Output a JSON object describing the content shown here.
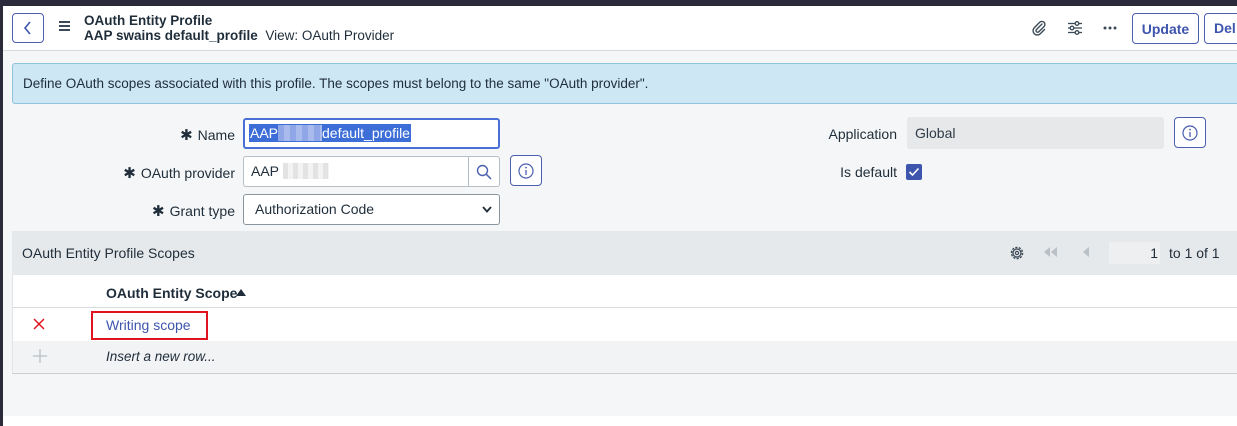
{
  "header": {
    "title": "OAuth Entity Profile",
    "record_name": "AAP swains default_profile",
    "view_label": "View: OAuth Provider",
    "update_label": "Update",
    "delete_label": "Del"
  },
  "banner": {
    "text": "Define OAuth scopes associated with this profile. The scopes must belong to the same \"OAuth provider\"."
  },
  "form": {
    "name_label": "Name",
    "name_prefix": "AAP",
    "name_suffix": "default_profile",
    "provider_label": "OAuth provider",
    "provider_value": "AAP",
    "grant_type_label": "Grant type",
    "grant_type_value": "Authorization Code",
    "application_label": "Application",
    "application_value": "Global",
    "is_default_label": "Is default",
    "is_default_checked": true
  },
  "related_list": {
    "title": "OAuth Entity Profile Scopes",
    "page_input": "1",
    "count_text": "to 1 of 1",
    "column_header": "OAuth Entity Scope",
    "rows": [
      {
        "scope": "Writing scope"
      }
    ],
    "insert_row_text": "Insert a new row..."
  },
  "colors": {
    "accent": "#3e55ad",
    "banner_bg": "#cde7f4",
    "highlight_border": "#e0141e"
  },
  "icons": [
    "chevron-left-icon",
    "hamburger-menu-icon",
    "paperclip-icon",
    "sliders-icon",
    "more-icon",
    "search-icon",
    "info-icon",
    "gear-icon",
    "first-page-icon",
    "prev-page-icon",
    "sort-ascending-icon",
    "delete-x-icon",
    "add-plus-icon",
    "checkmark-icon"
  ]
}
